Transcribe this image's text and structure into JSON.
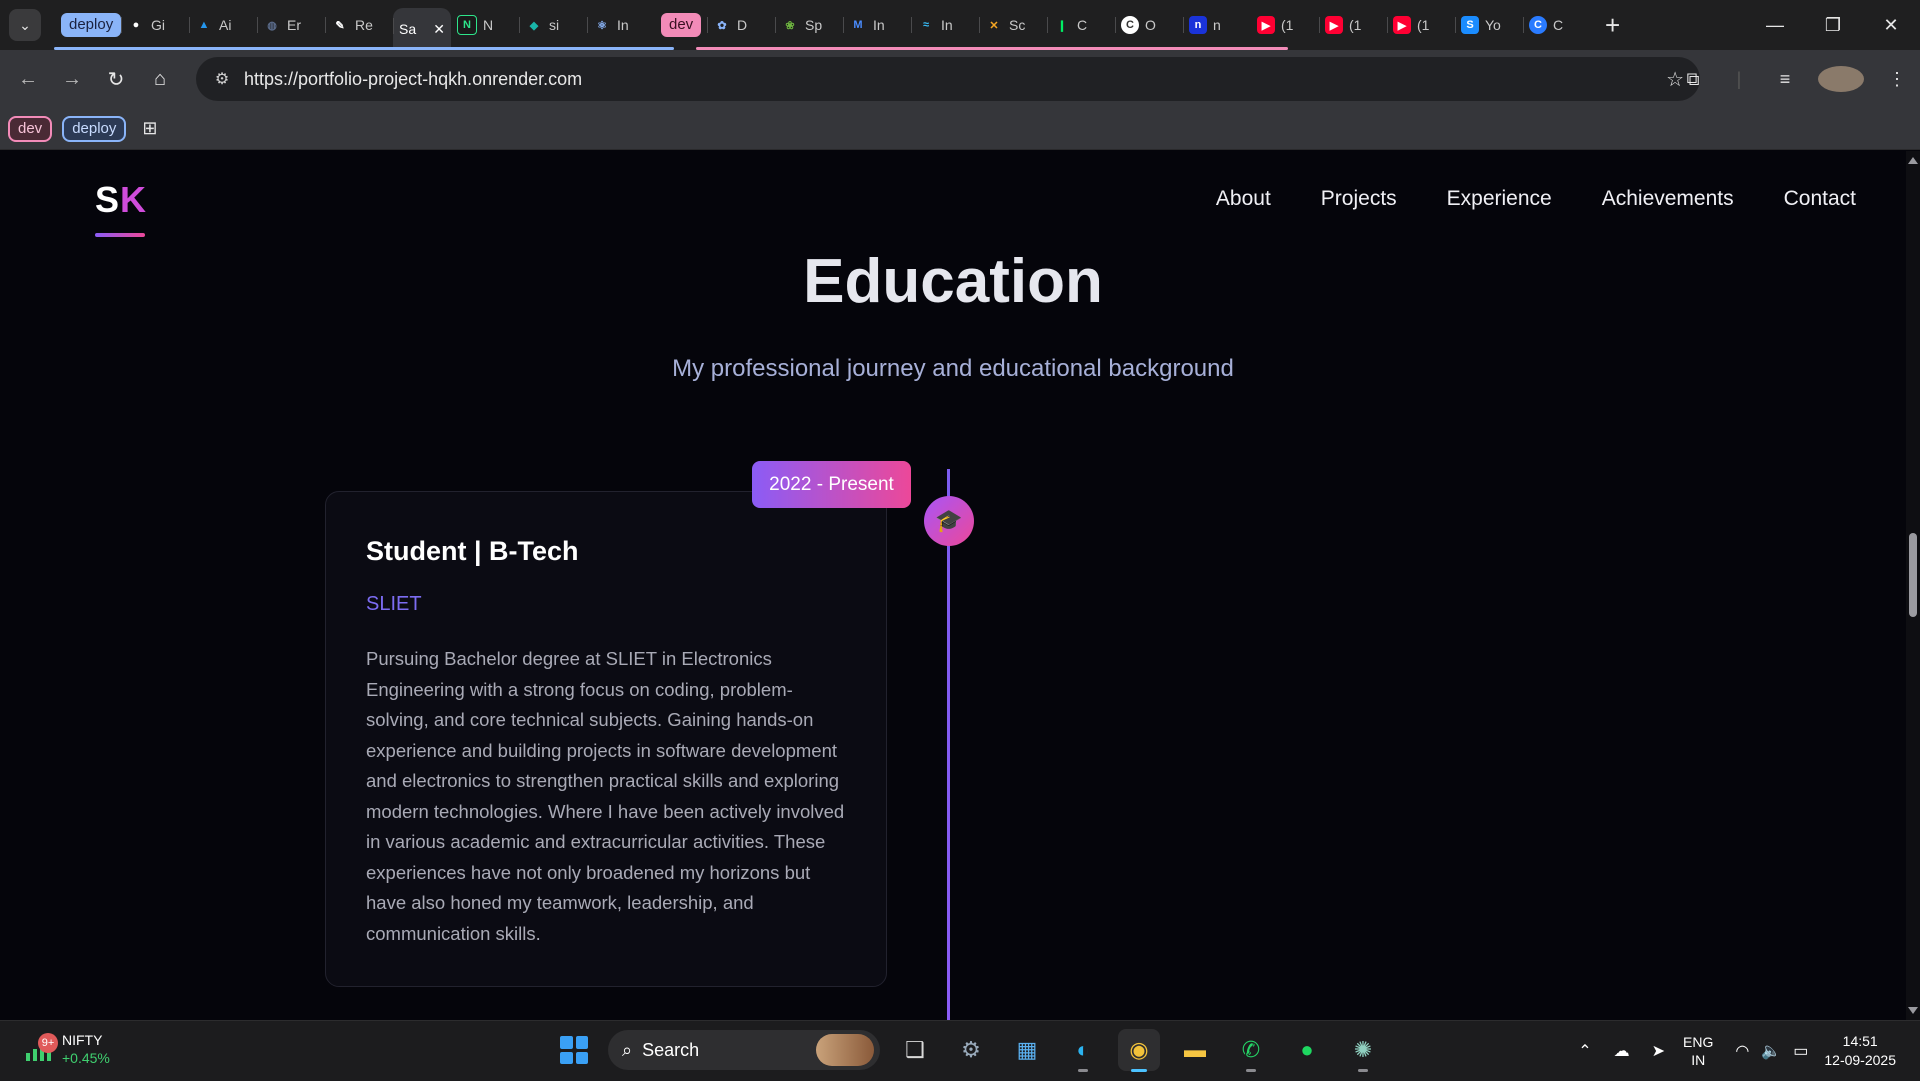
{
  "browser": {
    "tab_group_label": "deploy",
    "tabs": [
      {
        "label": "Gi",
        "icon": "github-icon"
      },
      {
        "label": "Ai",
        "icon": "docker-icon"
      },
      {
        "label": "Er",
        "icon": "globe-icon"
      },
      {
        "label": "Re",
        "icon": "render-icon"
      },
      {
        "label": "Sa",
        "icon": "site-icon",
        "active": true
      },
      {
        "label": "N",
        "icon": "n-icon"
      },
      {
        "label": "si",
        "icon": "diamond-icon"
      },
      {
        "label": "In",
        "icon": "react-icon"
      }
    ],
    "dev_group_label": "dev",
    "dev_tabs": [
      {
        "label": "D",
        "icon": "gear-icon"
      },
      {
        "label": "Sp",
        "icon": "spring-icon"
      },
      {
        "label": "In",
        "icon": "mui-icon"
      },
      {
        "label": "In",
        "icon": "tailwind-icon"
      },
      {
        "label": "Sc",
        "icon": "sc-icon"
      },
      {
        "label": "C",
        "icon": "leaf-icon"
      },
      {
        "label": "O",
        "icon": "c-icon"
      },
      {
        "label": "n",
        "icon": "n-icon"
      }
    ],
    "other_tabs": [
      {
        "label": "(1",
        "icon": "youtube-icon"
      },
      {
        "label": "(1",
        "icon": "youtube-icon"
      },
      {
        "label": "(1",
        "icon": "youtube-icon"
      },
      {
        "label": "Yo",
        "icon": "s-icon"
      },
      {
        "label": "C",
        "icon": "c-icon"
      }
    ],
    "url": "https://portfolio-project-hqkh.onrender.com",
    "bookmarks": {
      "dev": "dev",
      "deploy": "deploy"
    }
  },
  "site": {
    "logo_s": "S",
    "logo_k": "K",
    "nav": [
      "About",
      "Projects",
      "Experience",
      "Achievements",
      "Contact"
    ]
  },
  "education": {
    "title": "Education",
    "subtitle": "My professional journey and educational background",
    "entries": [
      {
        "date": "2022 - Present",
        "role": "Student | B-Tech",
        "institution": "SLIET",
        "description": "Pursuing Bachelor degree at SLIET in Electronics Engineering with a strong focus on coding, problem-solving, and core technical subjects. Gaining hands-on experience and building projects in software development and electronics to strengthen practical skills and exploring modern technologies. Where I have been actively involved in various academic and extracurricular activities. These experiences have not only broadened my horizons but have also honed my teamwork, leadership, and communication skills."
      }
    ]
  },
  "taskbar": {
    "widget_badge": "9+",
    "ticker_name": "NIFTY",
    "ticker_change": "+0.45%",
    "search_label": "Search",
    "lang_line1": "ENG",
    "lang_line2": "IN",
    "time": "14:51",
    "date": "12-09-2025"
  },
  "colors": {
    "accent_purple": "#8b5cf6",
    "accent_pink": "#ec4899",
    "institution": "#7c6cf2",
    "page_bg": "#05050b"
  }
}
